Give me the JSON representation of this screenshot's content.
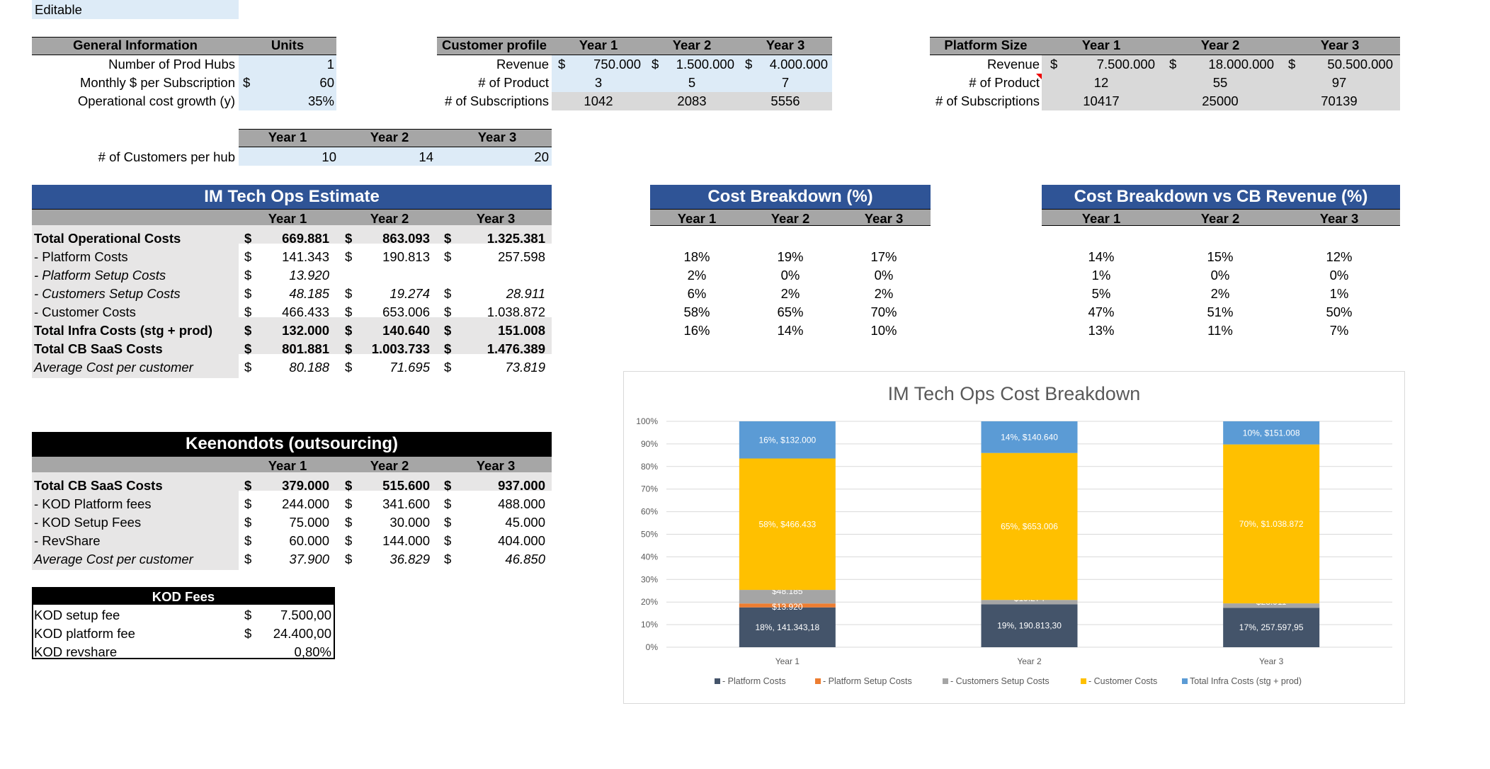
{
  "editable_label": "Editable",
  "general": {
    "headers": [
      "General Information",
      "Units"
    ],
    "rows": [
      {
        "label": "Number of Prod Hubs",
        "cur": "",
        "value": "1"
      },
      {
        "label": "Monthly $ per Subscription",
        "cur": "$",
        "value": "60"
      },
      {
        "label": "Operational cost growth (y)",
        "cur": "",
        "value": "35%"
      }
    ]
  },
  "customer_profile": {
    "headers": [
      "Customer profile",
      "Year 1",
      "Year 2",
      "Year 3"
    ],
    "rows": [
      {
        "label": "Revenue",
        "vals": [
          "750.000",
          "1.500.000",
          "4.000.000"
        ],
        "cur": "$"
      },
      {
        "label": "# of Product",
        "vals": [
          "3",
          "5",
          "7"
        ],
        "cur": ""
      },
      {
        "label": "# of Subscriptions",
        "vals": [
          "1042",
          "2083",
          "5556"
        ],
        "cur": ""
      }
    ]
  },
  "platform_size": {
    "headers": [
      "Platform Size",
      "Year 1",
      "Year 2",
      "Year 3"
    ],
    "rows": [
      {
        "label": "Revenue",
        "vals": [
          "7.500.000",
          "18.000.000",
          "50.500.000"
        ],
        "cur": "$"
      },
      {
        "label": "# of Product",
        "vals": [
          "12",
          "55",
          "97"
        ],
        "cur": ""
      },
      {
        "label": "# of Subscriptions",
        "vals": [
          "10417",
          "25000",
          "70139"
        ],
        "cur": ""
      }
    ]
  },
  "customers_per_hub": {
    "headers": [
      "Year 1",
      "Year 2",
      "Year 3"
    ],
    "label": "# of Customers per hub",
    "vals": [
      "10",
      "14",
      "20"
    ]
  },
  "im_tech": {
    "title": "IM Tech Ops Estimate",
    "years": [
      "Year 1",
      "Year 2",
      "Year 3"
    ],
    "rows": [
      {
        "label": "Total Operational Costs",
        "vals": [
          "669.881",
          "863.093",
          "1.325.381"
        ],
        "curs": [
          "$",
          "$",
          "$"
        ],
        "style": "b"
      },
      {
        "label": " - Platform Costs",
        "vals": [
          "141.343",
          "190.813",
          "257.598"
        ],
        "curs": [
          "$",
          "$",
          "$"
        ],
        "style": ""
      },
      {
        "label": " - Platform Setup Costs",
        "vals": [
          "13.920",
          "",
          ""
        ],
        "curs": [
          "$",
          "",
          ""
        ],
        "style": "i"
      },
      {
        "label": " - Customers Setup Costs",
        "vals": [
          "48.185",
          "19.274",
          "28.911"
        ],
        "curs": [
          "$",
          "$",
          "$"
        ],
        "style": "i"
      },
      {
        "label": " - Customer Costs",
        "vals": [
          "466.433",
          "653.006",
          "1.038.872"
        ],
        "curs": [
          "$",
          "$",
          "$"
        ],
        "style": ""
      },
      {
        "label": "Total Infra Costs (stg + prod)",
        "vals": [
          "132.000",
          "140.640",
          "151.008"
        ],
        "curs": [
          "$",
          "$",
          "$"
        ],
        "style": "b"
      },
      {
        "label": "Total CB SaaS Costs",
        "vals": [
          "801.881",
          "1.003.733",
          "1.476.389"
        ],
        "curs": [
          "$",
          "$",
          "$"
        ],
        "style": "b"
      },
      {
        "label": "Average Cost per customer",
        "vals": [
          "80.188",
          "71.695",
          "73.819"
        ],
        "curs": [
          "$",
          "$",
          "$"
        ],
        "style": "i"
      }
    ]
  },
  "cost_breakdown": {
    "title": "Cost Breakdown (%)",
    "years": [
      "Year 1",
      "Year 2",
      "Year 3"
    ],
    "rows": [
      [
        "18%",
        "19%",
        "17%"
      ],
      [
        "2%",
        "0%",
        "0%"
      ],
      [
        "6%",
        "2%",
        "2%"
      ],
      [
        "58%",
        "65%",
        "70%"
      ],
      [
        "16%",
        "14%",
        "10%"
      ]
    ]
  },
  "cost_vs_rev": {
    "title": "Cost Breakdown vs CB Revenue (%)",
    "years": [
      "Year 1",
      "Year 2",
      "Year 3"
    ],
    "rows": [
      [
        "14%",
        "15%",
        "12%"
      ],
      [
        "1%",
        "0%",
        "0%"
      ],
      [
        "5%",
        "2%",
        "1%"
      ],
      [
        "47%",
        "51%",
        "50%"
      ],
      [
        "13%",
        "11%",
        "7%"
      ]
    ]
  },
  "keenondots": {
    "title": "Keenondots (outsourcing)",
    "years": [
      "Year 1",
      "Year 2",
      "Year 3"
    ],
    "rows": [
      {
        "label": "Total CB SaaS Costs",
        "vals": [
          "379.000",
          "515.600",
          "937.000"
        ],
        "style": "b"
      },
      {
        "label": " - KOD Platform fees",
        "vals": [
          "244.000",
          "341.600",
          "488.000"
        ],
        "style": ""
      },
      {
        "label": " - KOD Setup Fees",
        "vals": [
          "75.000",
          "30.000",
          "45.000"
        ],
        "style": ""
      },
      {
        "label": " - RevShare",
        "vals": [
          "60.000",
          "144.000",
          "404.000"
        ],
        "style": ""
      },
      {
        "label": "Average Cost per customer",
        "vals": [
          "37.900",
          "36.829",
          "46.850"
        ],
        "style": "i"
      }
    ]
  },
  "kod_fees": {
    "title": "KOD Fees",
    "rows": [
      {
        "label": "KOD setup fee",
        "cur": "$",
        "value": "7.500,00"
      },
      {
        "label": "KOD platform fee",
        "cur": "$",
        "value": "24.400,00"
      },
      {
        "label": "KOD revshare",
        "cur": "",
        "value": "0,80%"
      }
    ]
  },
  "chart_data": {
    "type": "bar",
    "stacked": true,
    "percent_stacked": true,
    "title": "IM Tech Ops Cost Breakdown",
    "categories": [
      "Year 1",
      "Year 2",
      "Year 3"
    ],
    "ylim": [
      0,
      100
    ],
    "yticks": [
      "0%",
      "10%",
      "20%",
      "30%",
      "40%",
      "50%",
      "60%",
      "70%",
      "80%",
      "90%",
      "100%"
    ],
    "legend_position": "bottom",
    "series": [
      {
        "name": "- Platform Costs",
        "color": "#44546a",
        "values": [
          141343.18,
          190813.3,
          257597.95
        ],
        "labels": [
          "18%, 141.343,18",
          "19%, 190.813,30",
          "17%, 257.597,95"
        ]
      },
      {
        "name": "- Platform Setup Costs",
        "color": "#ed7d31",
        "values": [
          13920,
          0,
          0
        ],
        "labels": [
          "$13.920",
          "",
          ""
        ]
      },
      {
        "name": "- Customers Setup Costs",
        "color": "#a5a5a5",
        "values": [
          48185,
          19274,
          28911
        ],
        "labels": [
          "$48.185",
          "$19.274",
          "$28.911"
        ]
      },
      {
        "name": "- Customer Costs",
        "color": "#ffc000",
        "values": [
          466433,
          653006,
          1038872
        ],
        "labels": [
          "58%, $466.433",
          "65%, $653.006",
          "70%, $1.038.872"
        ]
      },
      {
        "name": "Total Infra Costs (stg + prod)",
        "color": "#5b9bd5",
        "values": [
          132000,
          140640,
          151008
        ],
        "labels": [
          "16%, $132.000",
          "14%, $140.640",
          "10%, $151.008"
        ]
      }
    ]
  }
}
